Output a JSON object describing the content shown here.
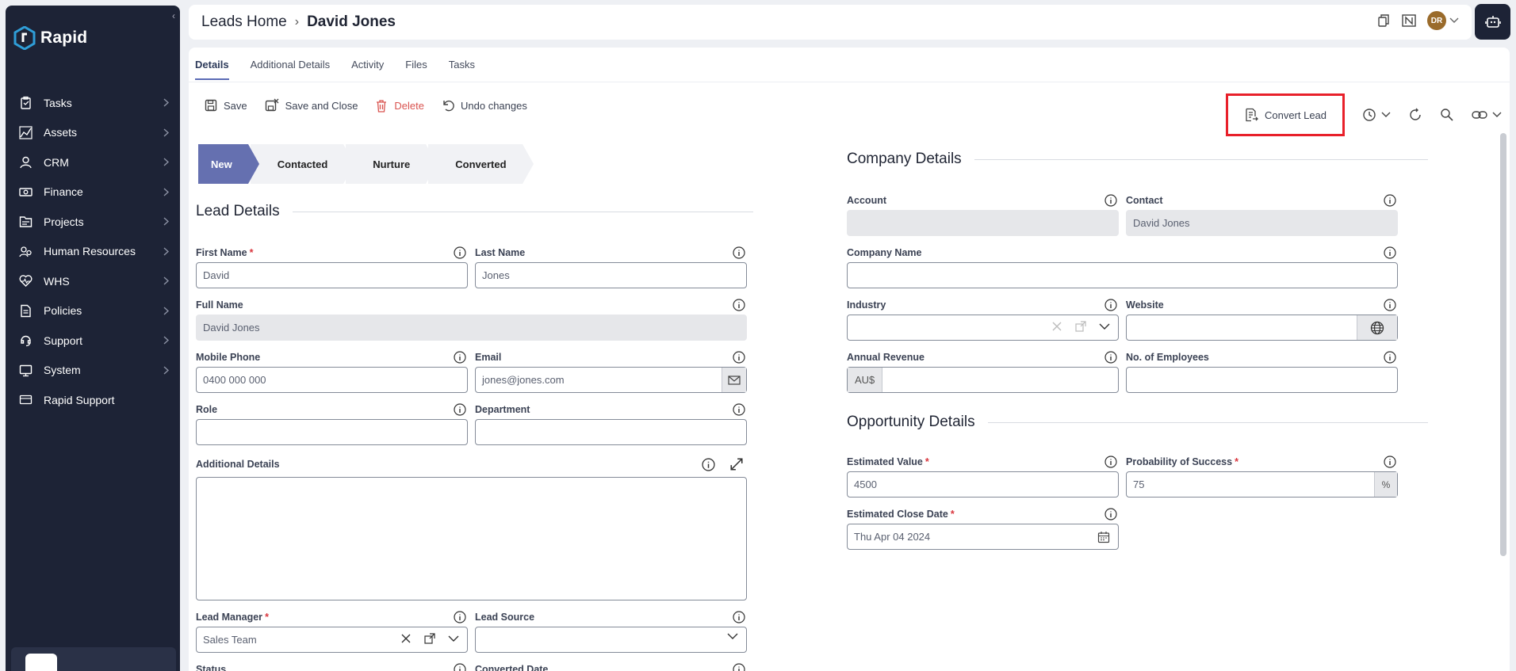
{
  "app": {
    "logo_text": "Rapid",
    "collapse_icon": "chevron-left-icon"
  },
  "sidebar": {
    "items": [
      {
        "label": "Tasks",
        "icon": "clipboard-icon",
        "has_children": true
      },
      {
        "label": "Assets",
        "icon": "assets-icon",
        "has_children": true
      },
      {
        "label": "CRM",
        "icon": "user-icon",
        "has_children": true
      },
      {
        "label": "Finance",
        "icon": "money-icon",
        "has_children": true
      },
      {
        "label": "Projects",
        "icon": "folder-icon",
        "has_children": true
      },
      {
        "label": "Human Resources",
        "icon": "people-icon",
        "has_children": true
      },
      {
        "label": "WHS",
        "icon": "heart-pulse-icon",
        "has_children": true
      },
      {
        "label": "Policies",
        "icon": "document-icon",
        "has_children": true
      },
      {
        "label": "Support",
        "icon": "support-icon",
        "has_children": true
      },
      {
        "label": "System",
        "icon": "system-icon",
        "has_children": true
      },
      {
        "label": "Rapid Support",
        "icon": "card-icon",
        "has_children": false
      }
    ]
  },
  "header": {
    "breadcrumb_parent": "Leads Home",
    "breadcrumb_current": "David Jones",
    "avatar_initials": "DR"
  },
  "tabs": [
    "Details",
    "Additional Details",
    "Activity",
    "Files",
    "Tasks"
  ],
  "toolbar": {
    "save": "Save",
    "save_close": "Save and Close",
    "delete": "Delete",
    "undo": "Undo changes",
    "convert_lead": "Convert Lead"
  },
  "stages": [
    "New",
    "Contacted",
    "Nurture",
    "Converted"
  ],
  "lead_details": {
    "title": "Lead Details",
    "first_name": {
      "label": "First Name",
      "value": "David"
    },
    "last_name": {
      "label": "Last Name",
      "value": "Jones"
    },
    "full_name": {
      "label": "Full Name",
      "value": "David Jones"
    },
    "mobile_phone": {
      "label": "Mobile Phone",
      "value": "0400 000 000"
    },
    "email": {
      "label": "Email",
      "value": "jones@jones.com"
    },
    "role": {
      "label": "Role",
      "value": ""
    },
    "department": {
      "label": "Department",
      "value": ""
    },
    "additional_details": {
      "label": "Additional Details",
      "value": ""
    },
    "lead_manager": {
      "label": "Lead Manager",
      "value": "Sales Team"
    },
    "lead_source": {
      "label": "Lead Source",
      "value": ""
    },
    "status": {
      "label": "Status"
    },
    "converted_date": {
      "label": "Converted Date"
    }
  },
  "company_details": {
    "title": "Company Details",
    "account": {
      "label": "Account",
      "value": ""
    },
    "contact": {
      "label": "Contact",
      "value": "David Jones"
    },
    "company_name": {
      "label": "Company Name",
      "value": ""
    },
    "industry": {
      "label": "Industry",
      "value": ""
    },
    "website": {
      "label": "Website",
      "value": ""
    },
    "annual_revenue": {
      "label": "Annual Revenue",
      "prefix": "AU$",
      "value": ""
    },
    "employees": {
      "label": "No. of Employees",
      "value": ""
    }
  },
  "opportunity_details": {
    "title": "Opportunity Details",
    "estimated_value": {
      "label": "Estimated Value",
      "value": "4500"
    },
    "probability": {
      "label": "Probability of Success",
      "value": "75",
      "suffix": "%"
    },
    "close_date": {
      "label": "Estimated Close Date",
      "value": "Thu Apr 04 2024"
    }
  },
  "colors": {
    "sidebar": "#1d2336",
    "accent": "#6570b0",
    "danger": "#d9534f",
    "highlight": "#e8202a"
  }
}
